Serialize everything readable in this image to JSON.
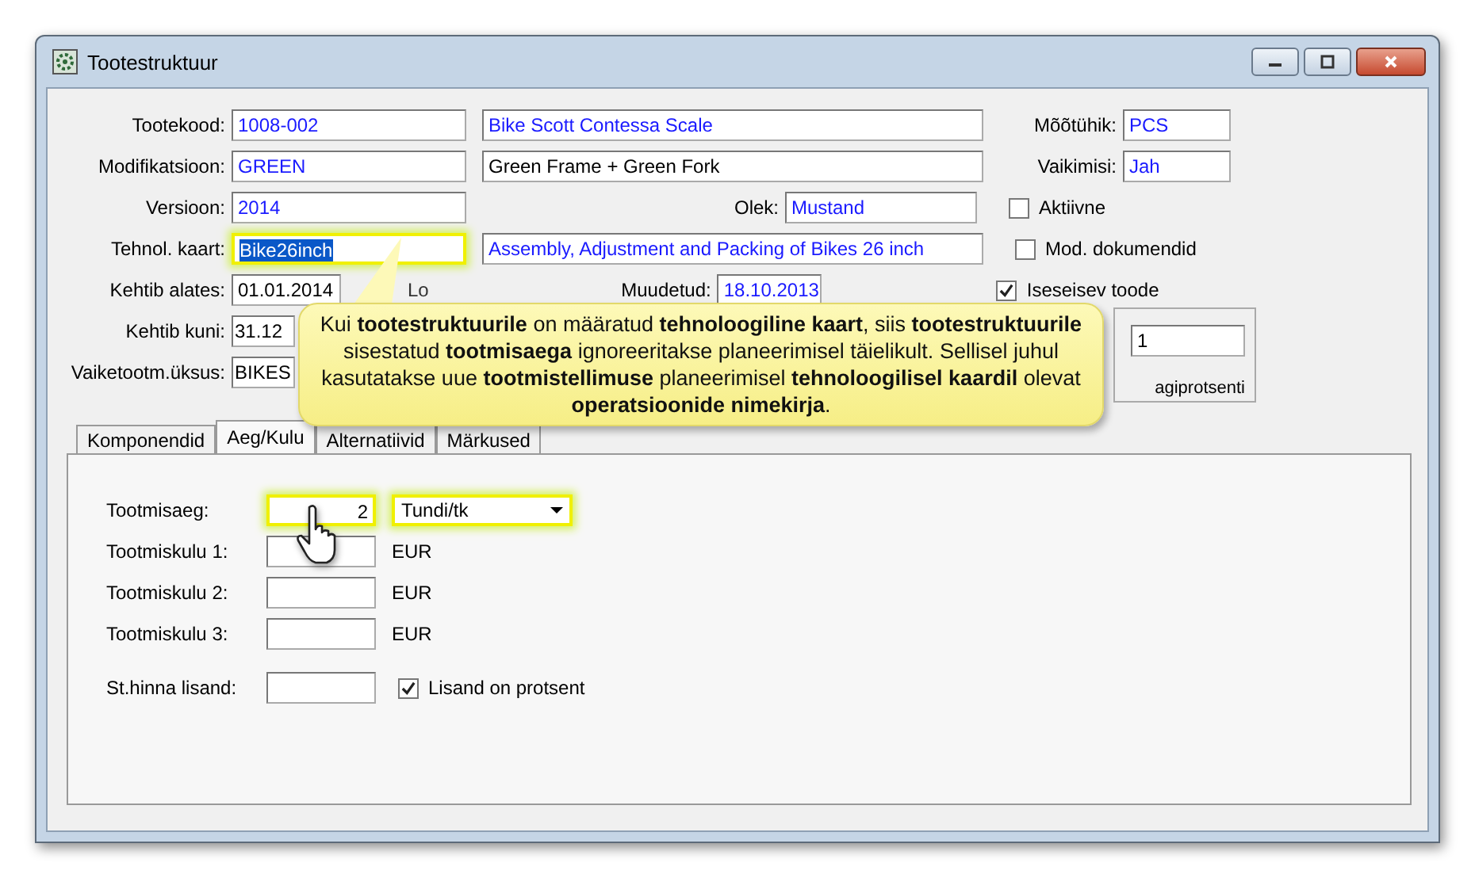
{
  "window": {
    "title": "Tootestruktuur"
  },
  "form": {
    "product_code": {
      "label": "Tootekood:",
      "value": "1008-002",
      "name": "Bike Scott Contessa Scale"
    },
    "modification": {
      "label": "Modifikatsioon:",
      "value": "GREEN",
      "name": "Green Frame + Green Fork"
    },
    "version": {
      "label": "Versioon:",
      "value": "2014"
    },
    "status": {
      "label": "Olek:",
      "value": "Mustand"
    },
    "tech_card": {
      "label": "Tehnol. kaart:",
      "value": "Bike26inch",
      "name": "Assembly, Adjustment and Packing of Bikes 26 inch",
      "highlighted": true,
      "text_selected": true
    },
    "valid_from": {
      "label": "Kehtib alates:",
      "value": "01.01.2014"
    },
    "created": {
      "label": "Lo"
    },
    "modified": {
      "label": "Muudetud:",
      "value": "18.10.2013"
    },
    "valid_to": {
      "label": "Kehtib kuni:",
      "value": "31.12"
    },
    "default_unit": {
      "label": "Vaiketootm.üksus:",
      "value": "BIKES"
    },
    "unit": {
      "label": "Mõõtühik:",
      "value": "PCS"
    },
    "default": {
      "label": "Vaikimisi:",
      "value": "Jah"
    },
    "checkboxes": [
      {
        "label": "Aktiivne",
        "checked": false
      },
      {
        "label": "Mod. dokumendid",
        "checked": false
      },
      {
        "label": "Iseseisev toode",
        "checked": true
      }
    ],
    "group": {
      "value": "1",
      "label": "agiprotsenti"
    }
  },
  "tabs": [
    {
      "label": "Komponendid",
      "selected": false
    },
    {
      "label": "Aeg/Kulu",
      "selected": true
    },
    {
      "label": "Alternatiivid",
      "selected": false
    },
    {
      "label": "Märkused",
      "selected": false
    }
  ],
  "panel": {
    "production_time": {
      "label": "Tootmisaeg:",
      "value": "2",
      "unit": "Tundi/tk",
      "highlighted": true
    },
    "costs": [
      {
        "label": "Tootmiskulu 1:",
        "currency": "EUR"
      },
      {
        "label": "Tootmiskulu 2:",
        "currency": "EUR"
      },
      {
        "label": "Tootmiskulu 3:",
        "currency": "EUR"
      }
    ],
    "surcharge": {
      "label": "St.hinna lisand:",
      "checkbox": {
        "label": "Lisand on protsent",
        "checked": true
      }
    }
  },
  "callout": {
    "text": "Kui **tootestruktuurile** on määratud **tehnoloogiline kaart**, siis **tootestruktuurile** sisestatud **tootmisaega** ignoreeritakse planeerimisel täielikult. Sellisel juhul kasutatakse uue **tootmistellimuse** planeerimisel **tehnoloogilisel kaardil** olevat **operatsioonide nimekirja**."
  }
}
